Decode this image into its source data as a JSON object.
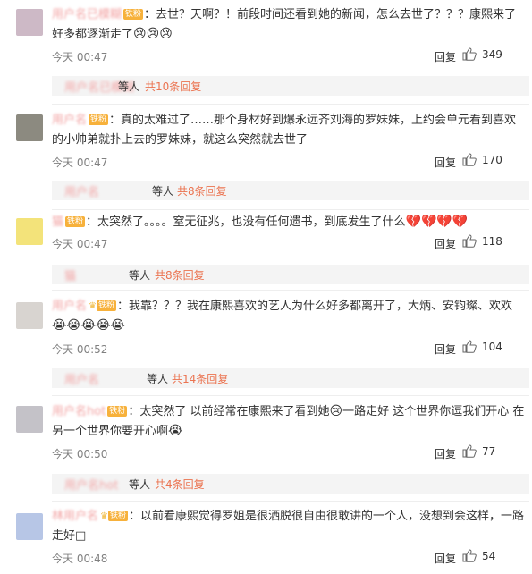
{
  "comments": [
    {
      "text": "：去世？天啊？！前段时间还看到她的新闻，怎么去世了？？？康熙来了好多都逐渐走了",
      "badge": "铁粉",
      "name_blur": "用户名已模糊",
      "time": "今天 00:47",
      "reply": "回复",
      "likes": "349",
      "sub_who": "等人",
      "sub_more": "共10条回复"
    },
    {
      "text": "：真的太难过了……那个身材好到爆永远齐刘海的罗妹妹，上约会单元看到喜欢的小帅弟就扑上去的罗妹妹，就这么突然就去世了",
      "badge": "铁粉",
      "name_blur": "用户名",
      "time": "今天 00:47",
      "reply": "回复",
      "likes": "170",
      "sub_who": "等人",
      "sub_more": "共8条回复"
    },
    {
      "text": "：太突然了。。。。窒无征兆，也没有任何遗书，到底发生了什么",
      "badge": "铁粉",
      "name_blur": "猫",
      "time": "今天 00:47",
      "reply": "回复",
      "likes": "118",
      "sub_who": "等人",
      "sub_more": "共8条回复"
    },
    {
      "text": "：我靠？？？我在康熙喜欢的艺人为什么好多都离开了，大炳、安钧璨、欢欢",
      "badge": "铁粉",
      "name_blur": "用户名",
      "time": "今天 00:52",
      "reply": "回复",
      "likes": "104",
      "sub_who": "等人",
      "sub_more": "共14条回复"
    },
    {
      "text": "：太突然了 以前经常在康熙来了看到她",
      "text2": "一路走好 这个世界你逗我们开心 在另一个世界你要开心啊",
      "badge": "铁粉",
      "name_blur": "用户名hot",
      "time": "今天 00:50",
      "reply": "回复",
      "likes": "77",
      "sub_who": "等人",
      "sub_more": "共4条回复"
    },
    {
      "text": "：以前看康熙觉得罗姐是很洒脱很自由很敢讲的一个人，没想到会这样，一路走好□",
      "badge": "铁粉",
      "name_blur": "林用户名",
      "time": "今天 00:48",
      "reply": "回复",
      "likes": "54"
    }
  ],
  "emoji": {
    "sad": "😢",
    "cry": "😭",
    "broken_heart": "💔"
  }
}
